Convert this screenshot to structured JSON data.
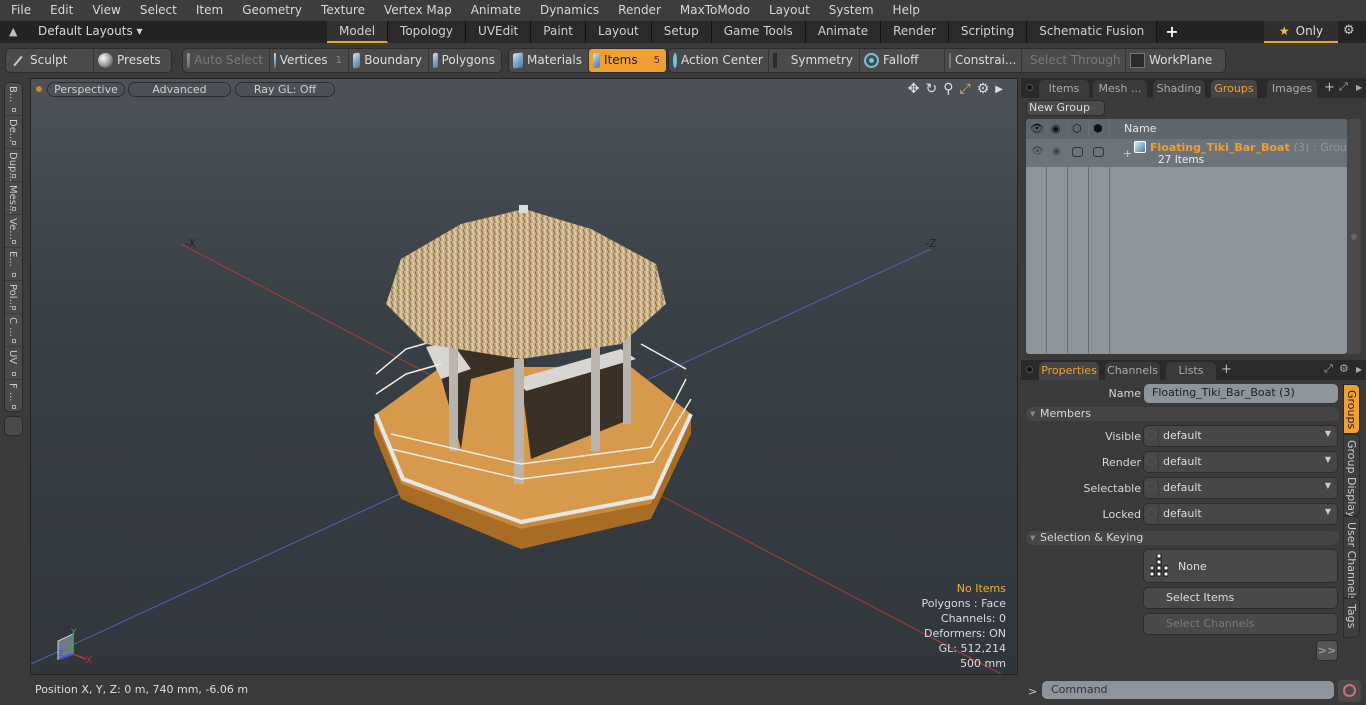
{
  "menubar": [
    "File",
    "Edit",
    "View",
    "Select",
    "Item",
    "Geometry",
    "Texture",
    "Vertex Map",
    "Animate",
    "Dynamics",
    "Render",
    "MaxToModo",
    "Layout",
    "System",
    "Help"
  ],
  "layoutbar": {
    "layouts_label": "Default Layouts ▾",
    "tabs": [
      "Model",
      "Topology",
      "UVEdit",
      "Paint",
      "Layout",
      "Setup",
      "Game Tools",
      "Animate",
      "Render",
      "Scripting",
      "Schematic Fusion"
    ],
    "active_tab": "Model",
    "add_tab": "+",
    "only_label": "Only",
    "star": "★",
    "gear": "⚙"
  },
  "toolbar": {
    "sculpt": "Sculpt",
    "presets": "Presets",
    "auto_select": "Auto Select",
    "vertices": "Vertices",
    "vertices_count": "1",
    "boundary": "Boundary",
    "polygons": "Polygons",
    "materials": "Materials",
    "items": "Items",
    "items_count": "5",
    "action_center": "Action Center",
    "symmetry": "Symmetry",
    "falloff": "Falloff",
    "constraints": "Constrai...",
    "select_through": "Select Through",
    "workplane": "WorkPlane"
  },
  "left_tabs": [
    "B...",
    "De...",
    "Dup...",
    "Mes...",
    "Ve...",
    "E...",
    "Pol...",
    "C ...",
    "UV",
    "F ..."
  ],
  "viewport": {
    "view_mode": "Perspective",
    "shading": "Advanced",
    "raygl": "Ray GL: Off",
    "axis_labels": {
      "neg_x": "-X",
      "neg_z": "-Z",
      "gizmo_x": "X",
      "gizmo_y": "Y",
      "gizmo_z": "Z"
    },
    "info": {
      "selection": "No Items",
      "polygons": "Polygons : Face",
      "channels": "Channels: 0",
      "deformers": "Deformers: ON",
      "gl": "GL: 512,214",
      "grid": "500 mm"
    }
  },
  "statusbar": {
    "position": "Position X, Y, Z:   0 m, 740 mm, -6.06 m"
  },
  "top_panel": {
    "tabs": [
      "Items",
      "Mesh ...",
      "Shading",
      "Groups",
      "Images"
    ],
    "active_tab": "Groups",
    "new_group": "New Group",
    "column_name": "Name",
    "group": {
      "name": "Floating_Tiki_Bar_Boat",
      "count": "(3)",
      "type": ": Group",
      "items": "27 Items",
      "expand": "+"
    }
  },
  "properties_panel": {
    "tabs": [
      "Properties",
      "Channels",
      "Lists"
    ],
    "active_tab": "Properties",
    "name_label": "Name",
    "name_value": "Floating_Tiki_Bar_Boat (3)",
    "members_section": "Members",
    "fields": [
      {
        "label": "Visible",
        "value": "default"
      },
      {
        "label": "Render",
        "value": "default"
      },
      {
        "label": "Selectable",
        "value": "default"
      },
      {
        "label": "Locked",
        "value": "default"
      }
    ],
    "selection_section": "Selection & Keying",
    "none_button": "None",
    "select_items": "Select Items",
    "select_channels": "Select Channels",
    "more": ">>",
    "side_tabs": [
      "Groups",
      "Group Display",
      "User Channels",
      "Tags"
    ],
    "active_side_tab": "Groups"
  },
  "command": {
    "prompt": ">",
    "placeholder": "Command"
  },
  "colors": {
    "accent": "#f0a030",
    "viewport_top": "#4c5257",
    "viewport_bottom": "#30363b",
    "list_bg": "#8d949c"
  }
}
